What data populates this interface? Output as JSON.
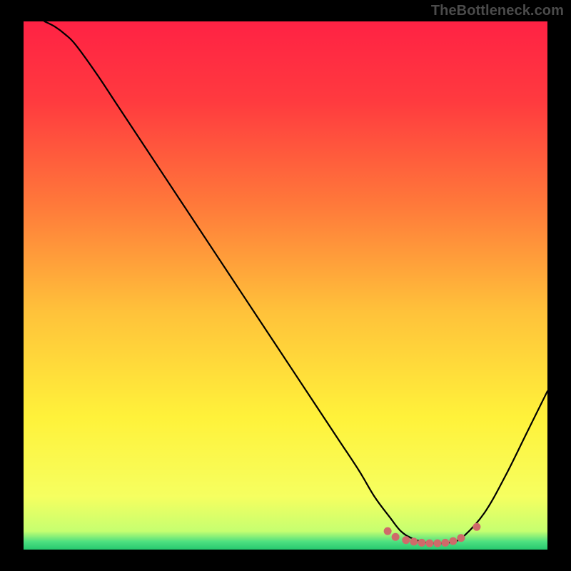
{
  "watermark": "TheBottleneck.com",
  "chart_data": {
    "type": "line",
    "title": "",
    "xlabel": "",
    "ylabel": "",
    "xlim": [
      0,
      100
    ],
    "ylim": [
      0,
      100
    ],
    "grid": false,
    "legend": false,
    "background_gradient": {
      "stops": [
        {
          "offset": 0.0,
          "color": "#ff2244"
        },
        {
          "offset": 0.15,
          "color": "#ff3a3f"
        },
        {
          "offset": 0.35,
          "color": "#ff7a3a"
        },
        {
          "offset": 0.55,
          "color": "#ffc23a"
        },
        {
          "offset": 0.75,
          "color": "#fff23a"
        },
        {
          "offset": 0.9,
          "color": "#f6ff60"
        },
        {
          "offset": 0.965,
          "color": "#c6ff70"
        },
        {
          "offset": 0.985,
          "color": "#4de080"
        },
        {
          "offset": 1.0,
          "color": "#27c86f"
        }
      ]
    },
    "series": [
      {
        "name": "curve",
        "color": "#000000",
        "stroke_width": 2.2,
        "x": [
          4,
          6,
          8,
          10,
          14,
          18,
          24,
          30,
          36,
          42,
          48,
          54,
          60,
          64,
          67,
          70,
          72,
          74,
          76,
          78,
          80,
          82,
          84,
          88,
          92,
          96,
          100
        ],
        "y": [
          100,
          99,
          97.5,
          95.5,
          90,
          84,
          75,
          66,
          57,
          48,
          39,
          30,
          21,
          15,
          10,
          6,
          3.5,
          2.2,
          1.5,
          1.2,
          1.2,
          1.5,
          2.5,
          7,
          14,
          22,
          30
        ]
      }
    ],
    "markers": {
      "name": "trough-dots",
      "color": "#cf6a6a",
      "radius": 5.5,
      "x": [
        69.5,
        71,
        73,
        74.5,
        76,
        77.5,
        79,
        80.5,
        82,
        83.5,
        86.5
      ],
      "y": [
        3.5,
        2.4,
        1.8,
        1.5,
        1.3,
        1.2,
        1.2,
        1.3,
        1.6,
        2.2,
        4.3
      ]
    }
  }
}
